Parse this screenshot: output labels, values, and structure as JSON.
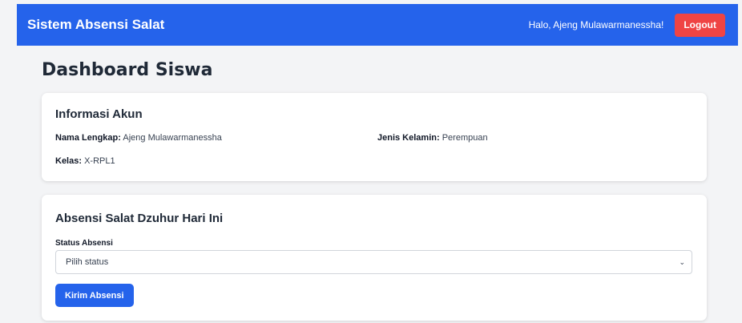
{
  "navbar": {
    "brand": "Sistem Absensi Salat",
    "greeting": "Halo, Ajeng Mulawarmanessha!",
    "logout_label": "Logout"
  },
  "page_title": "Dashboard Siswa",
  "account_card": {
    "title": "Informasi Akun",
    "name_label": "Nama Lengkap:",
    "name_value": "Ajeng Mulawarmanessha",
    "gender_label": "Jenis Kelamin:",
    "gender_value": "Perempuan",
    "class_label": "Kelas:",
    "class_value": "X-RPL1"
  },
  "attendance_card": {
    "title": "Absensi Salat Dzuhur Hari Ini",
    "status_label": "Status Absensi",
    "status_selected": "Pilih status",
    "submit_label": "Kirim Absensi"
  },
  "colors": {
    "primary": "#2563eb",
    "danger": "#ef4444",
    "background": "#f3f4f6"
  }
}
